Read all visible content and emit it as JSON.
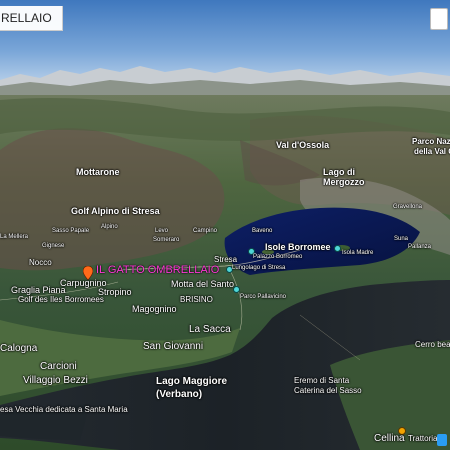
{
  "window": {
    "title": "RELLAIO"
  },
  "map": {
    "hotel_label": "IL GATTO OMBRELLAIO",
    "labels": {
      "val_dossola": "Val d'Ossola",
      "lago_di_mergozzo_1": "Lago di",
      "lago_di_mergozzo_2": "Mergozzo",
      "parco_naz_1": "Parco Naz",
      "parco_naz_2": "della Val G",
      "mottarone": "Mottarone",
      "golf_alpino": "Golf Alpino di Stresa",
      "alpino": "Alpino",
      "campino": "Campino",
      "isole_borromee": "Isole Borromee",
      "isola_madre": "Isola Madre",
      "stresa": "Stresa",
      "lungolago_stresa": "Lungolago di Stresa",
      "palazzo_borromeo": "Palazzo Borromeo",
      "parco_pallavicino": "Parco Pallavicino",
      "motta_del_santo": "Motta del Santo",
      "brisino": "BRISINO",
      "magognino": "Magognino",
      "la_sacca": "La Sacca",
      "san_giovanni": "San Giovanni",
      "nocco": "Nocco",
      "graglia_piana": "Graglia Piana",
      "carpugnino": "Carpugnino",
      "stropino": "Stropino",
      "golf_iles": "Golf des Iles Borromees",
      "calogna": "Calogna",
      "carcioni": "Carcioni",
      "villaggio_bezzi": "Villaggio Bezzi",
      "lago_maggiore_1": "Lago Maggiore",
      "lago_maggiore_2": "(Verbano)",
      "eremo_1": "Eremo di Santa",
      "eremo_2": "Caterina del Sasso",
      "cerro": "Cerro bea",
      "celina": "Cellina",
      "trattoria": "Trattoria",
      "chiesa": "esa Vecchia dedicata a Santa Maria",
      "gignese": "Gignese",
      "sasso_papale": "Sasso Papale",
      "levo": "Levo",
      "someraro": "Someraro",
      "baveno": "Baveno",
      "pallanza": "Pallanza",
      "suna": "Suna",
      "gravellona": "Gravellona",
      "la_mellera": "La Mellera",
      "motta_la": "La"
    },
    "colors": {
      "hotel_label": "#ff3ad8",
      "lake": "#0b1a5a",
      "sky": "#4f86c6"
    }
  }
}
